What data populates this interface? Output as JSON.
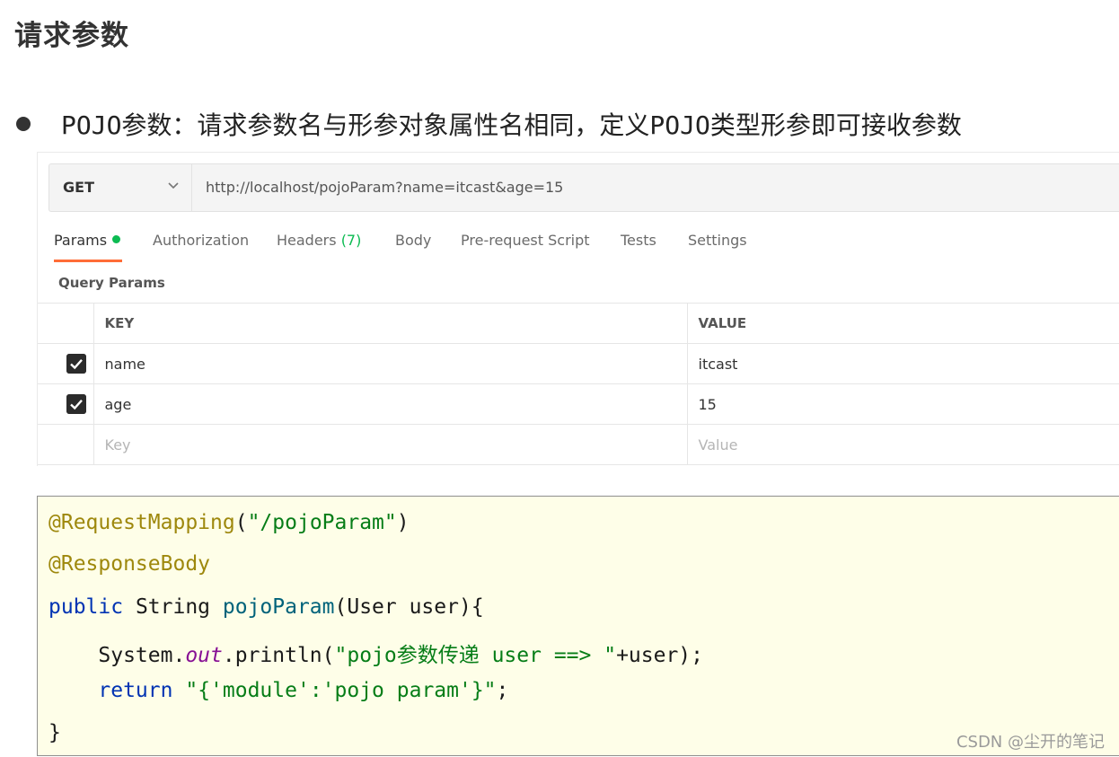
{
  "page": {
    "title": "请求参数",
    "bullet": "POJO参数：请求参数名与形参对象属性名相同，定义POJO类型形参即可接收参数"
  },
  "request": {
    "method": "GET",
    "url": "http://localhost/pojoParam?name=itcast&age=15"
  },
  "tabs": [
    {
      "label": "Params",
      "dot": true
    },
    {
      "label": "Authorization"
    },
    {
      "label": "Headers",
      "count": "(7)"
    },
    {
      "label": "Body"
    },
    {
      "label": "Pre-request Script"
    },
    {
      "label": "Tests"
    },
    {
      "label": "Settings"
    }
  ],
  "query_params": {
    "label": "Query Params",
    "headers": {
      "key": "KEY",
      "value": "VALUE"
    },
    "rows": [
      {
        "checked": true,
        "key": "name",
        "value": "itcast"
      },
      {
        "checked": true,
        "key": "age",
        "value": "15"
      }
    ],
    "placeholder": {
      "key": "Key",
      "value": "Value"
    }
  },
  "code": {
    "l1_ann": "@RequestMapping",
    "l1_open": "(",
    "l1_str": "\"/pojoParam\"",
    "l1_close": ")",
    "l2_ann": "@ResponseBody",
    "l3_kw": "public",
    "l3_type": " String ",
    "l3_fn": "pojoParam",
    "l3_rest": "(User user){",
    "l4_indent": "    System.",
    "l4_field": "out",
    "l4_mid": ".println(",
    "l4_str": "\"pojo参数传递 user ==> \"",
    "l4_rest": "+user);",
    "l5_indent": "    ",
    "l5_kw": "return",
    "l5_space": " ",
    "l5_str": "\"{'module':'pojo param'}\"",
    "l5_rest": ";",
    "l6": "}"
  },
  "watermark": "CSDN @尘开的笔记",
  "colors": {
    "accent_underline": "#ff6c37",
    "status_green": "#0cbb52",
    "code_bg": "#fefee8"
  }
}
